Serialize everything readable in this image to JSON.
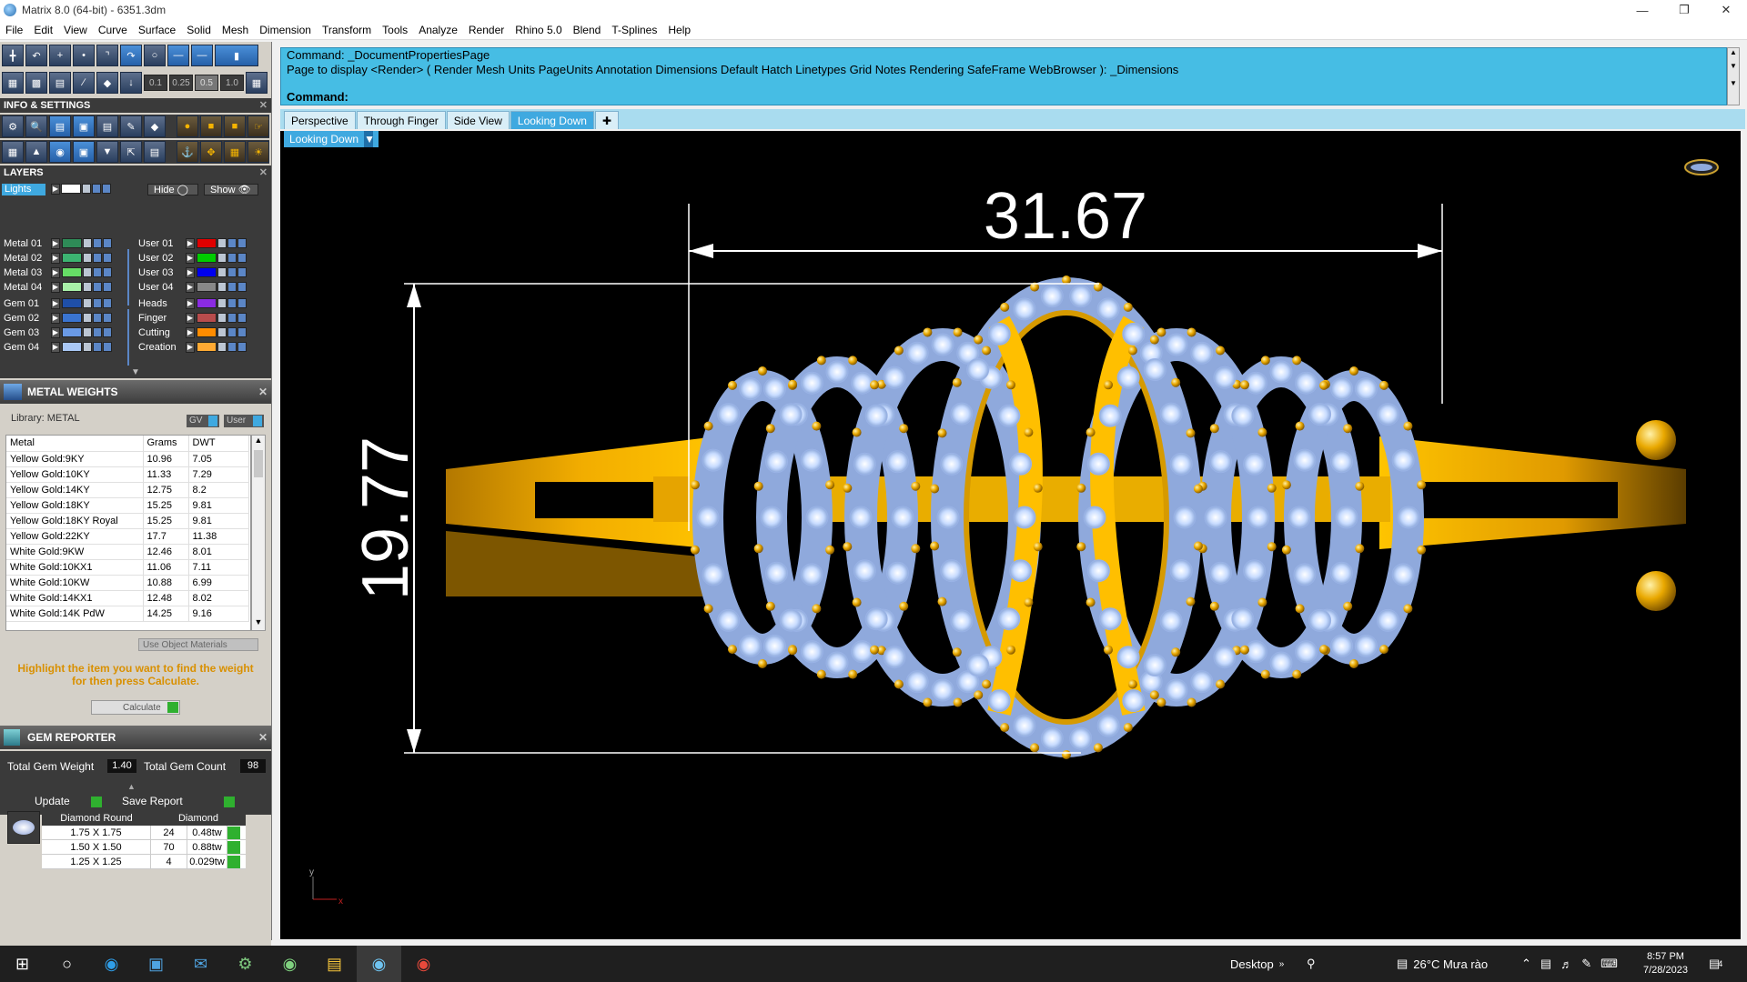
{
  "window": {
    "title": "Matrix 8.0 (64-bit) - 6351.3dm"
  },
  "menu": [
    "File",
    "Edit",
    "View",
    "Curve",
    "Surface",
    "Solid",
    "Mesh",
    "Dimension",
    "Transform",
    "Tools",
    "Analyze",
    "Render",
    "Rhino 5.0",
    "Blend",
    "T-Splines",
    "Help"
  ],
  "snap_values": [
    "0.1",
    "0.25",
    "0.5",
    "1.0"
  ],
  "command": {
    "line1": "Command: _DocumentPropertiesPage",
    "line2": "Page to display <Render> ( Render  Mesh  Units  PageUnits  Annotation  Dimensions  Default  Hatch  Linetypes  Grid  Notes  Rendering  SafeFrame  WebBrowser ): _Dimensions",
    "prompt": "Command:"
  },
  "tabs": [
    "Perspective",
    "Through Finger",
    "Side View",
    "Looking Down"
  ],
  "active_tab": "Looking Down",
  "viewport_label": "Looking Down",
  "info_settings": {
    "title": "INFO & SETTINGS"
  },
  "layers": {
    "title": "LAYERS",
    "lights": "Lights",
    "hide": "Hide",
    "show": "Show",
    "left": [
      {
        "name": "Metal 01",
        "color": "#2e8b57"
      },
      {
        "name": "Metal 02",
        "color": "#3cb371"
      },
      {
        "name": "Metal 03",
        "color": "#66dd66"
      },
      {
        "name": "Metal 04",
        "color": "#a8f0a8"
      },
      {
        "name": "Gem 01",
        "color": "#1f4fa8"
      },
      {
        "name": "Gem 02",
        "color": "#3a74d0"
      },
      {
        "name": "Gem 03",
        "color": "#6a9ae6"
      },
      {
        "name": "Gem 04",
        "color": "#a9c7f5"
      }
    ],
    "right": [
      {
        "name": "User 01",
        "color": "#e00000"
      },
      {
        "name": "User 02",
        "color": "#00cc00"
      },
      {
        "name": "User 03",
        "color": "#0000ee"
      },
      {
        "name": "User 04",
        "color": "#888888"
      },
      {
        "name": "Heads",
        "color": "#8a2be2"
      },
      {
        "name": "Finger",
        "color": "#b84c4c"
      },
      {
        "name": "Cutting",
        "color": "#ff8c00"
      },
      {
        "name": "Creation",
        "color": "#ffaa33"
      }
    ]
  },
  "metal_weights": {
    "title": "METAL WEIGHTS",
    "library": "Library: METAL",
    "gv": "GV",
    "user": "User",
    "columns": [
      "Metal",
      "Grams",
      "DWT"
    ],
    "rows": [
      [
        "Yellow Gold:9KY",
        "10.96",
        "7.05"
      ],
      [
        "Yellow Gold:10KY",
        "11.33",
        "7.29"
      ],
      [
        "Yellow Gold:14KY",
        "12.75",
        "8.2"
      ],
      [
        "Yellow Gold:18KY",
        "15.25",
        "9.81"
      ],
      [
        "Yellow Gold:18KY Royal",
        "15.25",
        "9.81"
      ],
      [
        "Yellow Gold:22KY",
        "17.7",
        "11.38"
      ],
      [
        "White Gold:9KW",
        "12.46",
        "8.01"
      ],
      [
        "White Gold:10KX1",
        "11.06",
        "7.11"
      ],
      [
        "White Gold:10KW",
        "10.88",
        "6.99"
      ],
      [
        "White Gold:14KX1",
        "12.48",
        "8.02"
      ],
      [
        "White Gold:14K PdW",
        "14.25",
        "9.16"
      ]
    ],
    "use_object_materials": "Use Object Materials",
    "hint": "Highlight the item you want to find the weight for then press Calculate.",
    "calculate": "Calculate"
  },
  "gem_reporter": {
    "title": "GEM REPORTER",
    "total_weight_label": "Total Gem Weight",
    "total_weight": "1.40",
    "total_count_label": "Total Gem Count",
    "total_count": "98",
    "update": "Update",
    "save_report": "Save Report",
    "columns": [
      "Diamond Round",
      "Diamond"
    ],
    "rows": [
      [
        "1.75 X 1.75",
        "24",
        "0.48tw"
      ],
      [
        "1.50 X 1.50",
        "70",
        "0.88tw"
      ],
      [
        "1.25 X 1.25",
        "4",
        "0.029tw"
      ]
    ]
  },
  "dimensions": {
    "width": "31.67",
    "height": "19.77"
  },
  "axis": {
    "y": "y",
    "x": "x"
  },
  "taskbar": {
    "desktop": "Desktop",
    "weather": "26°C  Mưa rào",
    "time": "8:57 PM",
    "date": "7/28/2023",
    "notif": "4"
  },
  "colors": {
    "command_bg": "#46bde4",
    "tab_active": "#3fa9e0",
    "gold": "#f5b400",
    "diamond": "#cfe3ff"
  }
}
